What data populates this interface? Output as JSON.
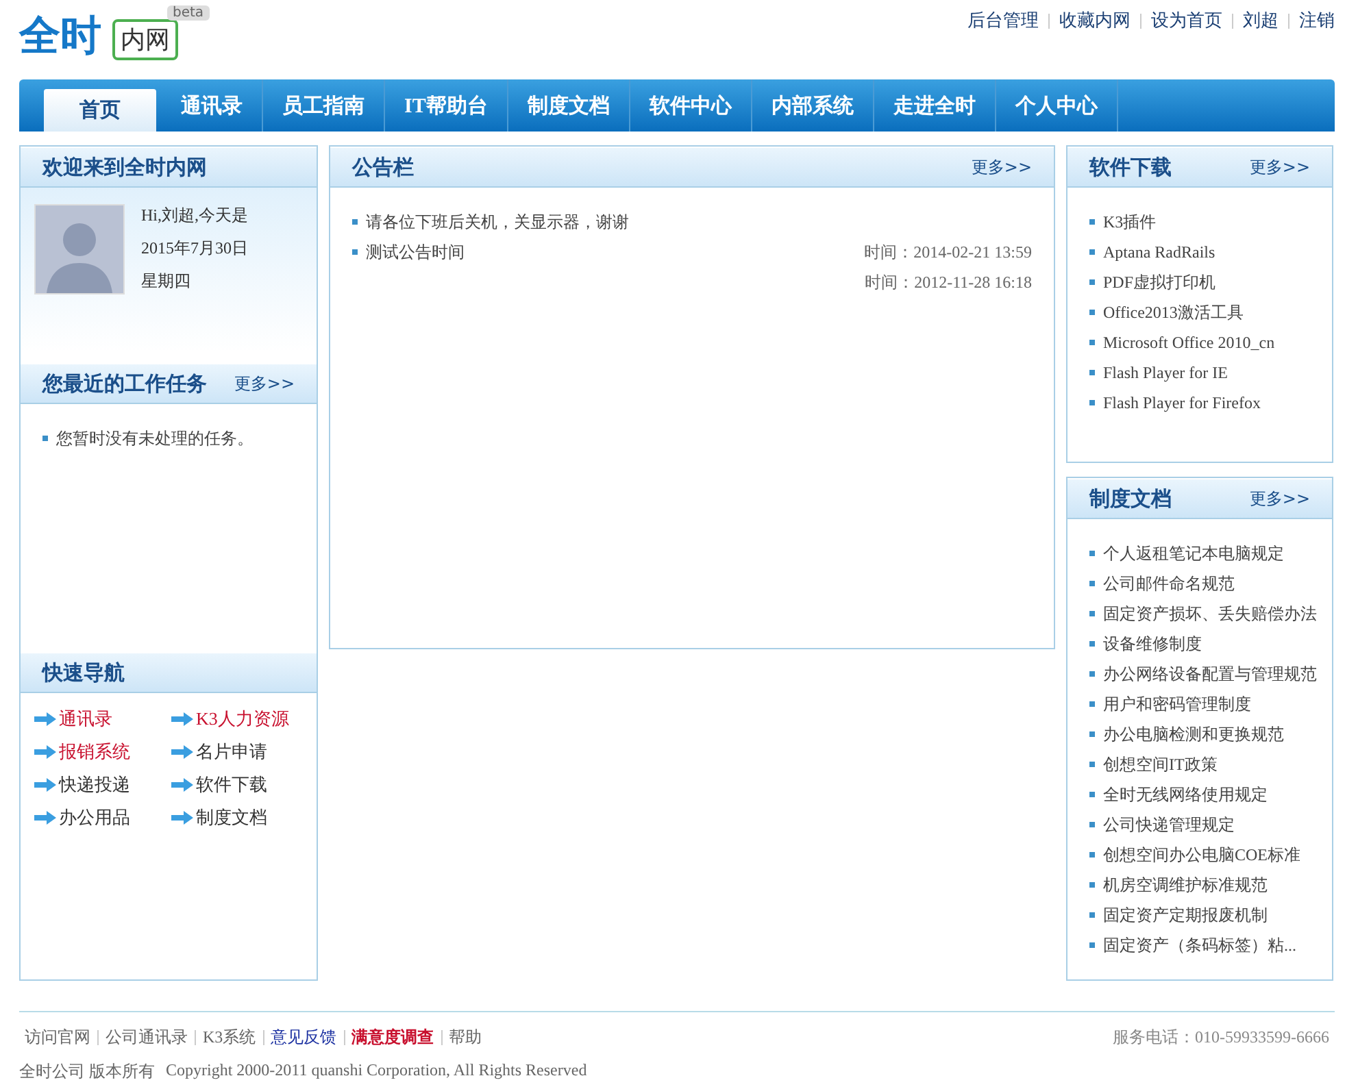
{
  "header": {
    "logo": {
      "brand": "全时",
      "label": "内网",
      "badge": "beta"
    },
    "top_links": [
      "后台管理",
      "收藏内网",
      "设为首页",
      "刘超",
      "注销"
    ]
  },
  "nav": [
    {
      "label": "首页",
      "selected": true
    },
    {
      "label": "通讯录",
      "selected": false
    },
    {
      "label": "员工指南",
      "selected": false
    },
    {
      "label": "IT帮助台",
      "selected": false
    },
    {
      "label": "制度文档",
      "selected": false
    },
    {
      "label": "软件中心",
      "selected": false
    },
    {
      "label": "内部系统",
      "selected": false
    },
    {
      "label": "走进全时",
      "selected": false
    },
    {
      "label": "个人中心",
      "selected": false
    }
  ],
  "welcome": {
    "title": "欢迎来到全时内网",
    "greeting": "Hi,刘超,今天是",
    "date": "2015年7月30日",
    "weekday": "星期四"
  },
  "tasks": {
    "title": "您最近的工作任务",
    "more": "更多>>",
    "items": [
      "您暂时没有未处理的任务。"
    ]
  },
  "quick_nav": {
    "title": "快速导航",
    "items": [
      {
        "label": "通讯录",
        "highlight": true
      },
      {
        "label": "K3人力资源",
        "highlight": true
      },
      {
        "label": "报销系统",
        "highlight": true
      },
      {
        "label": "名片申请",
        "highlight": false
      },
      {
        "label": "快递投递",
        "highlight": false
      },
      {
        "label": "软件下载",
        "highlight": false
      },
      {
        "label": "办公用品",
        "highlight": false
      },
      {
        "label": "制度文档",
        "highlight": false
      }
    ]
  },
  "notices": {
    "title": "公告栏",
    "more": "更多>>",
    "items": [
      {
        "title": "请各位下班后关机，关显示器，谢谢"
      },
      {
        "title": "测试公告时间",
        "time": "时间：2014-02-21 13:59"
      },
      {
        "time": "时间：2012-11-28 16:18"
      }
    ]
  },
  "software": {
    "title": "软件下载",
    "more": "更多>>",
    "items": [
      "K3插件",
      "Aptana RadRails",
      "PDF虚拟打印机",
      "Office2013激活工具",
      "Microsoft Office 2010_cn",
      "Flash Player for IE",
      "Flash Player for Firefox"
    ]
  },
  "documents": {
    "title": "制度文档",
    "more": "更多>>",
    "items": [
      "个人返租笔记本电脑规定",
      "公司邮件命名规范",
      "固定资产损坏、丢失赔偿办法",
      "设备维修制度",
      "办公网络设备配置与管理规范",
      "用户和密码管理制度",
      "办公电脑检测和更换规范",
      "创想空间IT政策",
      "全时无线网络使用规定",
      "公司快递管理规定",
      "创想空间办公电脑COE标准",
      "机房空调维护标准规范",
      "固定资产定期报废机制",
      "固定资产（条码标签）粘..."
    ]
  },
  "footer": {
    "links": [
      {
        "label": "访问官网",
        "kind": "normal"
      },
      {
        "label": "公司通讯录",
        "kind": "normal"
      },
      {
        "label": "K3系统",
        "kind": "normal"
      },
      {
        "label": "意见反馈",
        "kind": "accent"
      },
      {
        "label": "满意度调查",
        "kind": "strong"
      },
      {
        "label": "帮助",
        "kind": "normal"
      }
    ],
    "phone": "服务电话：010-59933599-6666",
    "copyright_owner": "全时公司  版本所有",
    "copyright": "Copyright 2000-2011 quanshi Corporation, All Rights Reserved"
  }
}
